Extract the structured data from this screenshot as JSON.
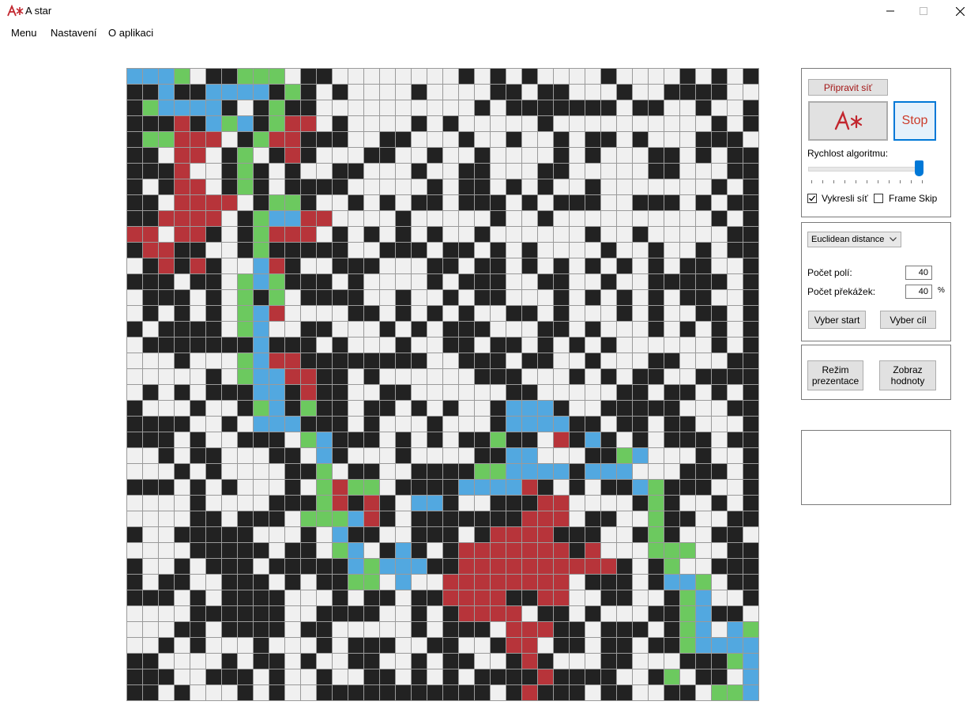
{
  "window": {
    "title": "A star"
  },
  "menu": {
    "items": [
      "Menu",
      "Nastavení",
      "O aplikaci"
    ]
  },
  "colors": {
    "wall": "#222222",
    "empty": "#f0f0f0",
    "grid_line": "#9a9a9a",
    "path": "#52a8e0",
    "open": "#6cc95f",
    "closed": "#b7343a",
    "accent": "#0078d7",
    "stop_text": "#cc3b2a",
    "astar_text": "#c2262e"
  },
  "controls": {
    "prepare_button": "Připravit síť",
    "astar_button_icon": "astar-logo",
    "stop_button": "Stop",
    "speed_label": "Rychlost algoritmu:",
    "speed_value": 1.0,
    "draw_grid_label": "Vykresli síť",
    "draw_grid_checked": true,
    "frame_skip_label": "Frame Skip",
    "frame_skip_checked": false,
    "heuristic_select": "Euclidean distance",
    "cell_count_label": "Počet polí:",
    "cell_count_value": "40",
    "obstacle_label": "Počet překážek:",
    "obstacle_value": "40",
    "obstacle_unit": "%",
    "select_start_button": "Vyber start",
    "select_goal_button": "Vyber cíl",
    "presentation_button": "Režim prezentace",
    "show_values_button": "Zobraz hodnoty"
  },
  "grid": {
    "size": 40,
    "legend": "0=empty,1=wall,2=path,3=open,4=closed",
    "rows": [
      "2223011333011000000001010100001000010101",
      "1121122221310100001000011011000100111100",
      "1322221013110000000000101111111011001001",
      "1114123213440100001010000010000000000101",
      "1334440134411100110001001001011010001110",
      "1104401301410001100100100001010001101011",
      "1114001310100110001001100011000001100011",
      "1014401310111100000101101010010000000101",
      "1104444013310010101101110101110011101011",
      "1144440132244000010000010010000000000101",
      "4404410134440101010100100000010010000011",
      "1441100131111100111011010100001001001011",
      "0141410024100111000110110101010101011001",
      "1110110323111010000101110011001001111101",
      "0111010313011110010010110001010101011001",
      "0101010324000011010101001101000101001101",
      "1011110320011000101011100011010001010101",
      "0111111121110100010011011010101000000101",
      "0001000324411111111001110110010001100011",
      "0000010322441101000000111000101011001111",
      "0101011122141100110000001100000110110101",
      "1000100132131101101010012221001111100011",
      "1111001022211101000100012222110110110001",
      "1110100111032111010101131104121010111011",
      "0010110001102100010000112200011320001001",
      "0001010000113011001111332222122200011101",
      "1110101000103433011112222410101123111001",
      "0000100001113414102210011144000013100101",
      "0000110111033324101111111444011003110011",
      "1001111100010211001110144441110013100110",
      "0000111110110320121014444444140003330011",
      "1001011101111123222114444444444101300111",
      "1011001110101133020044444444011101223011",
      "1110101111000101101144441144001100132001",
      "0000111111001111001014444011010001132110",
      "0001101111011000001011104441101110132023",
      "0010100010001011100110014401101101132222",
      "1100001011010011001011001410001100011132",
      "1110011101001001101010111141111001301102",
      "1101000101001111111111101411101100110332"
    ]
  }
}
